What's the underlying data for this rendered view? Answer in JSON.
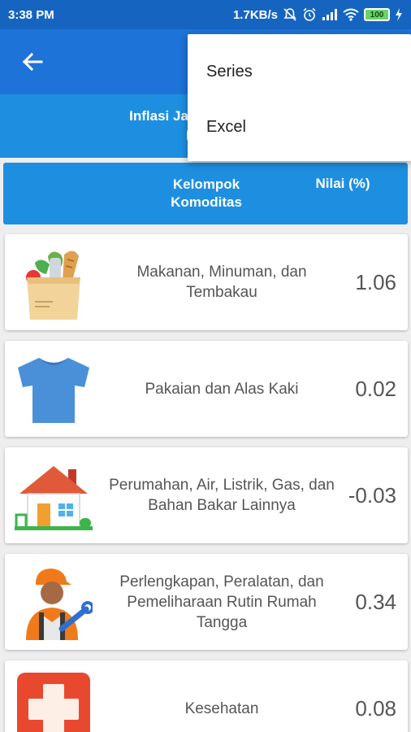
{
  "status_bar": {
    "time": "3:38 PM",
    "network_speed": "1.7KB/s",
    "battery": "100",
    "icons": [
      "mute-icon",
      "alarm-icon",
      "signal-icon",
      "wifi-icon",
      "battery-icon",
      "charging-icon"
    ]
  },
  "app_bar": {
    "back_icon": "arrow-back-icon"
  },
  "banner": {
    "line1": "Inflasi Jawa Tengah Me",
    "line2": "Nover"
  },
  "table_header": {
    "column1": "Kelompok Komoditas",
    "column2": "Nilai (%)"
  },
  "rows": [
    {
      "icon": "groceries-icon",
      "name": "Makanan, Minuman, dan Tembakau",
      "value": "1.06"
    },
    {
      "icon": "tshirt-icon",
      "name": "Pakaian dan Alas Kaki",
      "value": "0.02"
    },
    {
      "icon": "house-icon",
      "name": "Perumahan, Air, Listrik, Gas, dan Bahan Bakar Lainnya",
      "value": "-0.03"
    },
    {
      "icon": "repairman-icon",
      "name": "Perlengkapan, Peralatan, dan Pemeliharaan Rutin Rumah Tangga",
      "value": "0.34"
    },
    {
      "icon": "health-cross-icon",
      "name": "Kesehatan",
      "value": "0.08"
    }
  ],
  "menu": {
    "items": [
      {
        "label": "Series"
      },
      {
        "label": "Excel"
      }
    ]
  },
  "colors": {
    "status_bar": "#1565c0",
    "app_bar": "#1e73d8",
    "header": "#1e8fe0",
    "background": "#eeeeee"
  }
}
